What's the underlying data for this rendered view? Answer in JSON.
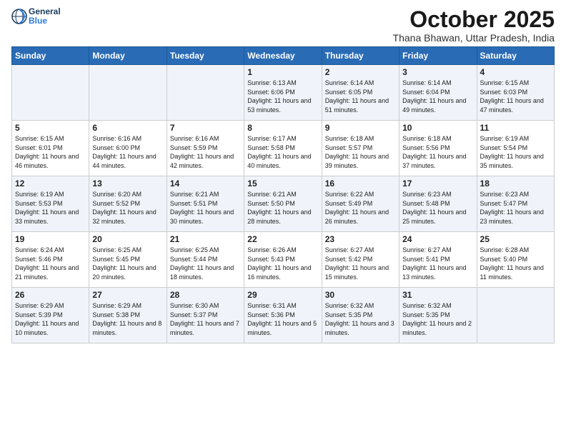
{
  "header": {
    "logo_general": "General",
    "logo_blue": "Blue",
    "month_title": "October 2025",
    "location": "Thana Bhawan, Uttar Pradesh, India"
  },
  "weekdays": [
    "Sunday",
    "Monday",
    "Tuesday",
    "Wednesday",
    "Thursday",
    "Friday",
    "Saturday"
  ],
  "weeks": [
    [
      {
        "day": "",
        "info": ""
      },
      {
        "day": "",
        "info": ""
      },
      {
        "day": "",
        "info": ""
      },
      {
        "day": "1",
        "info": "Sunrise: 6:13 AM\nSunset: 6:06 PM\nDaylight: 11 hours and 53 minutes."
      },
      {
        "day": "2",
        "info": "Sunrise: 6:14 AM\nSunset: 6:05 PM\nDaylight: 11 hours and 51 minutes."
      },
      {
        "day": "3",
        "info": "Sunrise: 6:14 AM\nSunset: 6:04 PM\nDaylight: 11 hours and 49 minutes."
      },
      {
        "day": "4",
        "info": "Sunrise: 6:15 AM\nSunset: 6:03 PM\nDaylight: 11 hours and 47 minutes."
      }
    ],
    [
      {
        "day": "5",
        "info": "Sunrise: 6:15 AM\nSunset: 6:01 PM\nDaylight: 11 hours and 46 minutes."
      },
      {
        "day": "6",
        "info": "Sunrise: 6:16 AM\nSunset: 6:00 PM\nDaylight: 11 hours and 44 minutes."
      },
      {
        "day": "7",
        "info": "Sunrise: 6:16 AM\nSunset: 5:59 PM\nDaylight: 11 hours and 42 minutes."
      },
      {
        "day": "8",
        "info": "Sunrise: 6:17 AM\nSunset: 5:58 PM\nDaylight: 11 hours and 40 minutes."
      },
      {
        "day": "9",
        "info": "Sunrise: 6:18 AM\nSunset: 5:57 PM\nDaylight: 11 hours and 39 minutes."
      },
      {
        "day": "10",
        "info": "Sunrise: 6:18 AM\nSunset: 5:56 PM\nDaylight: 11 hours and 37 minutes."
      },
      {
        "day": "11",
        "info": "Sunrise: 6:19 AM\nSunset: 5:54 PM\nDaylight: 11 hours and 35 minutes."
      }
    ],
    [
      {
        "day": "12",
        "info": "Sunrise: 6:19 AM\nSunset: 5:53 PM\nDaylight: 11 hours and 33 minutes."
      },
      {
        "day": "13",
        "info": "Sunrise: 6:20 AM\nSunset: 5:52 PM\nDaylight: 11 hours and 32 minutes."
      },
      {
        "day": "14",
        "info": "Sunrise: 6:21 AM\nSunset: 5:51 PM\nDaylight: 11 hours and 30 minutes."
      },
      {
        "day": "15",
        "info": "Sunrise: 6:21 AM\nSunset: 5:50 PM\nDaylight: 11 hours and 28 minutes."
      },
      {
        "day": "16",
        "info": "Sunrise: 6:22 AM\nSunset: 5:49 PM\nDaylight: 11 hours and 26 minutes."
      },
      {
        "day": "17",
        "info": "Sunrise: 6:23 AM\nSunset: 5:48 PM\nDaylight: 11 hours and 25 minutes."
      },
      {
        "day": "18",
        "info": "Sunrise: 6:23 AM\nSunset: 5:47 PM\nDaylight: 11 hours and 23 minutes."
      }
    ],
    [
      {
        "day": "19",
        "info": "Sunrise: 6:24 AM\nSunset: 5:46 PM\nDaylight: 11 hours and 21 minutes."
      },
      {
        "day": "20",
        "info": "Sunrise: 6:25 AM\nSunset: 5:45 PM\nDaylight: 11 hours and 20 minutes."
      },
      {
        "day": "21",
        "info": "Sunrise: 6:25 AM\nSunset: 5:44 PM\nDaylight: 11 hours and 18 minutes."
      },
      {
        "day": "22",
        "info": "Sunrise: 6:26 AM\nSunset: 5:43 PM\nDaylight: 11 hours and 16 minutes."
      },
      {
        "day": "23",
        "info": "Sunrise: 6:27 AM\nSunset: 5:42 PM\nDaylight: 11 hours and 15 minutes."
      },
      {
        "day": "24",
        "info": "Sunrise: 6:27 AM\nSunset: 5:41 PM\nDaylight: 11 hours and 13 minutes."
      },
      {
        "day": "25",
        "info": "Sunrise: 6:28 AM\nSunset: 5:40 PM\nDaylight: 11 hours and 11 minutes."
      }
    ],
    [
      {
        "day": "26",
        "info": "Sunrise: 6:29 AM\nSunset: 5:39 PM\nDaylight: 11 hours and 10 minutes."
      },
      {
        "day": "27",
        "info": "Sunrise: 6:29 AM\nSunset: 5:38 PM\nDaylight: 11 hours and 8 minutes."
      },
      {
        "day": "28",
        "info": "Sunrise: 6:30 AM\nSunset: 5:37 PM\nDaylight: 11 hours and 7 minutes."
      },
      {
        "day": "29",
        "info": "Sunrise: 6:31 AM\nSunset: 5:36 PM\nDaylight: 11 hours and 5 minutes."
      },
      {
        "day": "30",
        "info": "Sunrise: 6:32 AM\nSunset: 5:35 PM\nDaylight: 11 hours and 3 minutes."
      },
      {
        "day": "31",
        "info": "Sunrise: 6:32 AM\nSunset: 5:35 PM\nDaylight: 11 hours and 2 minutes."
      },
      {
        "day": "",
        "info": ""
      }
    ]
  ]
}
